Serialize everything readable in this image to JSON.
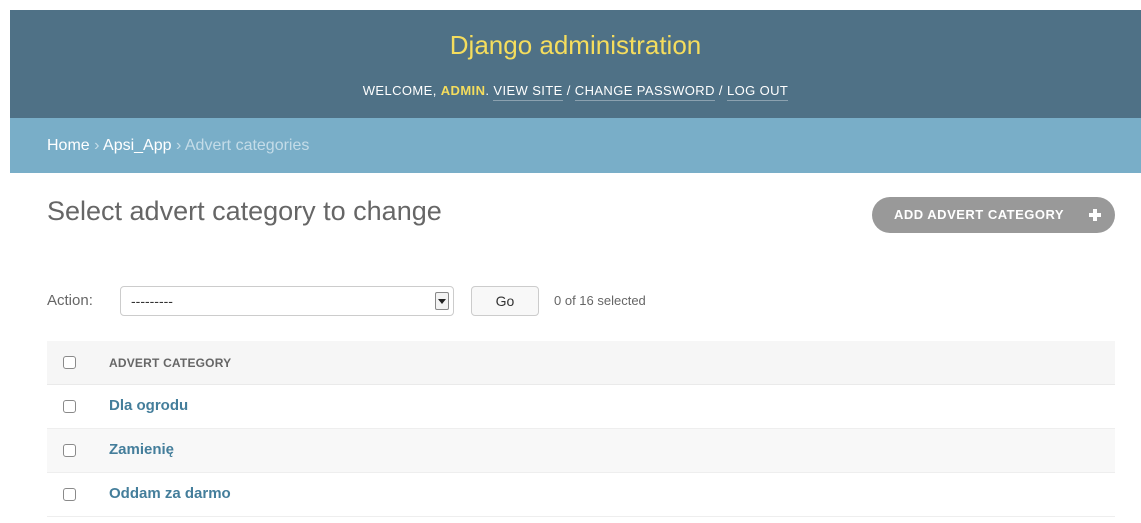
{
  "header": {
    "site_title": "Django administration",
    "welcome_prefix": "Welcome, ",
    "username": "admin",
    "username_suffix": ".",
    "view_site": "View site",
    "change_password": "Change password",
    "log_out": "Log out",
    "separator": "/"
  },
  "breadcrumbs": {
    "home": "Home",
    "app": "Apsi_App",
    "current": "Advert categories",
    "separator": "›"
  },
  "content": {
    "title": "Select advert category to change",
    "add_button": "ADD ADVERT CATEGORY"
  },
  "actions": {
    "label": "Action:",
    "selected_value": "---------",
    "go": "Go",
    "selected_count": "0 of 16 selected"
  },
  "table": {
    "column_header": "ADVERT CATEGORY",
    "rows": [
      "Dla ogrodu",
      "Zamienię",
      "Oddam za darmo"
    ]
  },
  "colors": {
    "header_bg": "#4f7186",
    "title": "#f5dd5d",
    "breadcrumbs_bg": "#79aec8",
    "link": "#447e9b",
    "add_button_bg": "#999999"
  }
}
